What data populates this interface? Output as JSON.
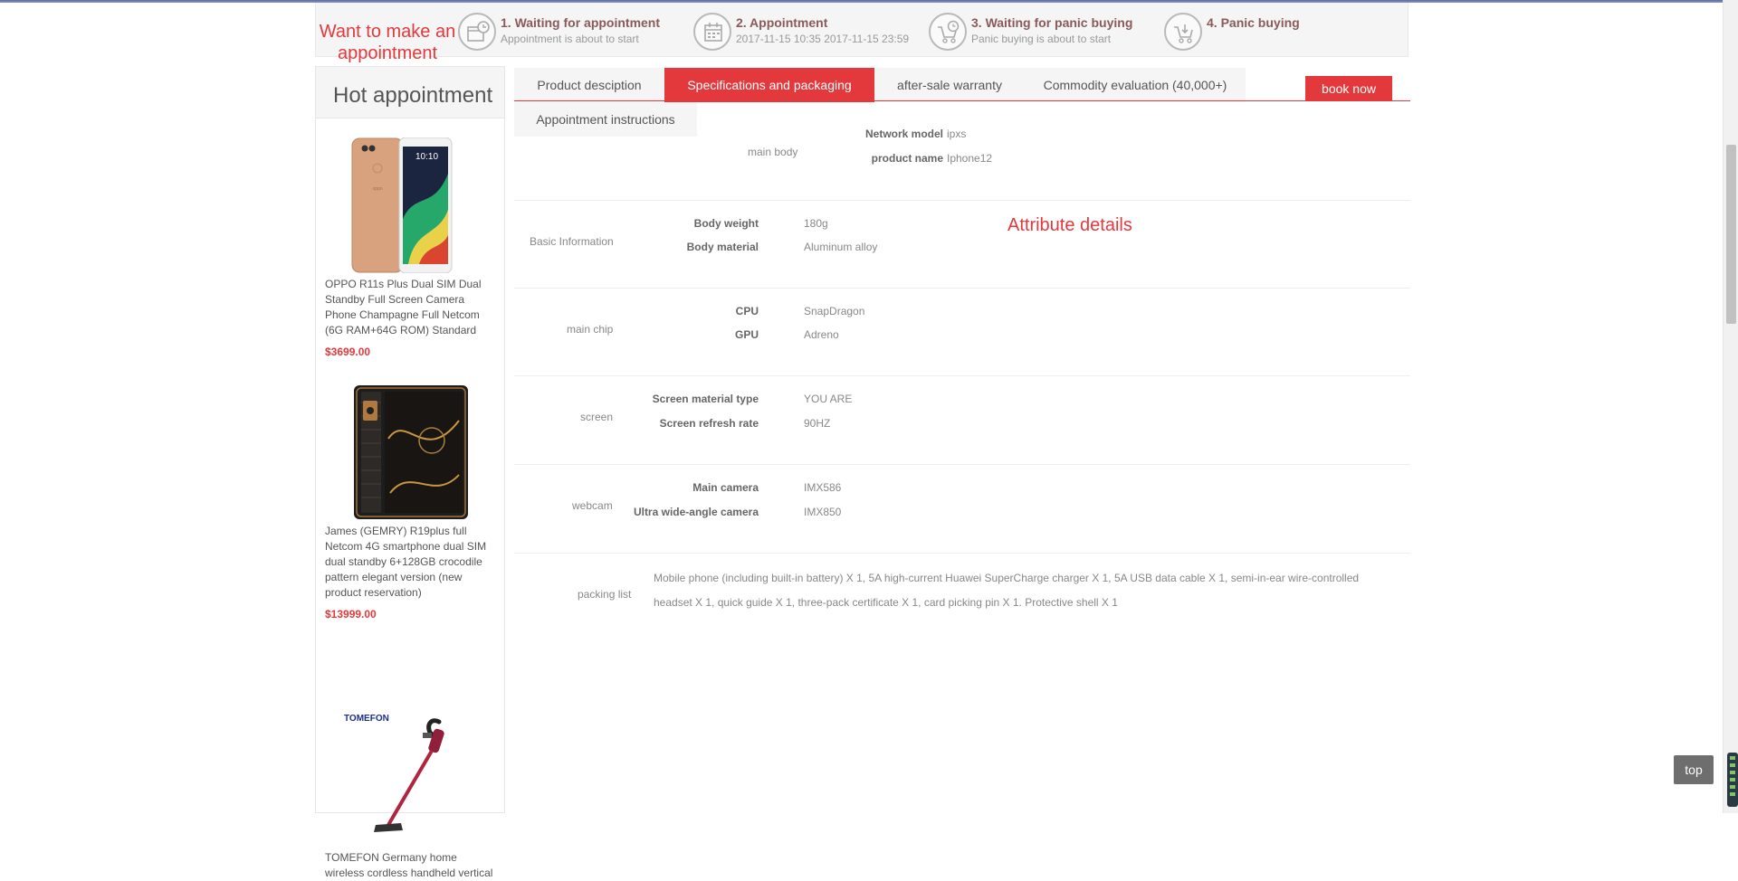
{
  "appointment": {
    "title": "Want to make an appointment",
    "steps": [
      {
        "title": "1. Waiting for appointment",
        "desc": "Appointment is about to start",
        "icon": "clock-calendar-icon"
      },
      {
        "title": "2. Appointment",
        "desc": "2017-11-15 10:35 2017-11-15 23:59",
        "icon": "calendar-icon"
      },
      {
        "title": "3. Waiting for panic buying",
        "desc": "Panic buying is about to start",
        "icon": "cart-clock-icon"
      },
      {
        "title": "4. Panic buying",
        "desc": "",
        "icon": "cart-download-icon"
      }
    ]
  },
  "sidebar": {
    "title": "Hot appointment",
    "products": [
      {
        "name": "OPPO R11s Plus Dual SIM Dual Standby Full Screen Camera Phone Champagne Full Netcom (6G RAM+64G ROM) Standard",
        "price": "$3699.00"
      },
      {
        "name": "James (GEMRY) R19plus full Netcom 4G smartphone dual SIM dual standby 6+128GB crocodile pattern elegant version (new product reservation)",
        "price": "$13999.00"
      },
      {
        "name": "TOMEFON Germany home wireless cordless handheld vertical",
        "brand": "TOMEFON",
        "price": ""
      }
    ]
  },
  "tabs": {
    "items": [
      "Product desciption",
      "Specifications and packaging",
      "after-sale warranty",
      "Commodity evaluation (40,000+)",
      "Appointment instructions"
    ],
    "active_index": 1,
    "book_label": "book now"
  },
  "attributes": {
    "caption": "Attribute details",
    "groups": [
      {
        "name": "main body",
        "rows": [
          {
            "key": "Network model",
            "value": "ipxs"
          },
          {
            "key": "product name",
            "value": "Iphone12"
          }
        ]
      },
      {
        "name": "Basic Information",
        "rows": [
          {
            "key": "Body weight",
            "value": "180g"
          },
          {
            "key": "Body material",
            "value": "Aluminum alloy"
          }
        ]
      },
      {
        "name": "main chip",
        "rows": [
          {
            "key": "CPU",
            "value": "SnapDragon"
          },
          {
            "key": "GPU",
            "value": "Adreno"
          }
        ]
      },
      {
        "name": "screen",
        "rows": [
          {
            "key": "Screen material type",
            "value": "YOU ARE"
          },
          {
            "key": "Screen refresh rate",
            "value": "90HZ"
          }
        ]
      },
      {
        "name": "webcam",
        "rows": [
          {
            "key": "Main camera",
            "value": "IMX586"
          },
          {
            "key": "Ultra wide-angle camera",
            "value": "IMX850"
          }
        ]
      }
    ],
    "packing": {
      "name": "packing list",
      "text": "Mobile phone (including built-in battery) X 1, 5A high-current Huawei SuperCharge charger X 1, 5A USB data cable X 1, semi-in-ear wire-controlled headset X 1, quick guide X 1, three-pack certificate X 1, card picking pin X 1. Protective shell X 1"
    }
  },
  "back_to_top": "top",
  "colors": {
    "accent": "#e4393c",
    "panel": "#f5f5f5"
  }
}
